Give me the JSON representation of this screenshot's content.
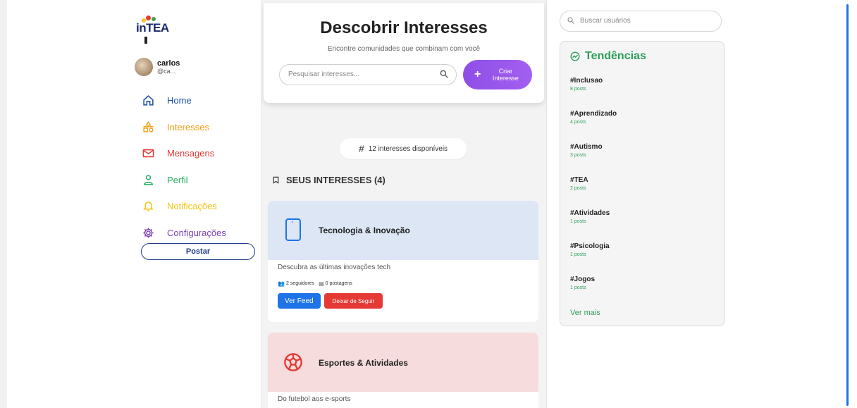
{
  "logo": {
    "word_in": "in",
    "word_tea": "TEA"
  },
  "user": {
    "name": "carlos",
    "handle": "@ca..."
  },
  "nav": [
    {
      "label": "Home",
      "icon": "home-icon",
      "color": "#1e4fa8"
    },
    {
      "label": "Interesses",
      "icon": "shapes-icon",
      "color": "#f39c12"
    },
    {
      "label": "Mensagens",
      "icon": "mail-icon",
      "color": "#e53935"
    },
    {
      "label": "Perfil",
      "icon": "user-icon",
      "color": "#27ae60"
    },
    {
      "label": "Notificações",
      "icon": "bell-icon",
      "color": "#f1c40f"
    },
    {
      "label": "Configurações",
      "icon": "gear-icon",
      "color": "#7b3fb5"
    }
  ],
  "post_button": "Postar",
  "discover": {
    "title": "Descobrir Interesses",
    "subtitle": "Encontre comunidades que combinam com você",
    "search_placeholder": "Pesquisar interesses...",
    "create_label": "Criar Interesse"
  },
  "count_pill": "12 interesses disponíveis",
  "section_title": "SEUS INTERESSES (4)",
  "interests": [
    {
      "title": "Tecnologia & Inovação",
      "icon": "phone-icon",
      "banner_color": "#dce6f4",
      "description": "Descubra as últimas inovações tech",
      "followers": "2 seguidores",
      "posts": "0 postagens",
      "feed_label": "Ver Feed",
      "unfollow_label": "Deixar de Seguir"
    },
    {
      "title": "Esportes & Atividades",
      "icon": "ball-icon",
      "banner_color": "#f6dcdc",
      "description": "Do futebol aos e-sports"
    }
  ],
  "user_search_placeholder": "Buscar usuários",
  "trends": {
    "title": "Tendências",
    "items": [
      {
        "tag": "#Inclusao",
        "count": "8 posts"
      },
      {
        "tag": "#Aprendizado",
        "count": "4 posts"
      },
      {
        "tag": "#Autismo",
        "count": "3 posts"
      },
      {
        "tag": "#TEA",
        "count": "2 posts"
      },
      {
        "tag": "#Atividades",
        "count": "1 posts"
      },
      {
        "tag": "#Psicologia",
        "count": "1 posts"
      },
      {
        "tag": "#Jogos",
        "count": "1 posts"
      }
    ],
    "see_more": "Ver mais"
  }
}
